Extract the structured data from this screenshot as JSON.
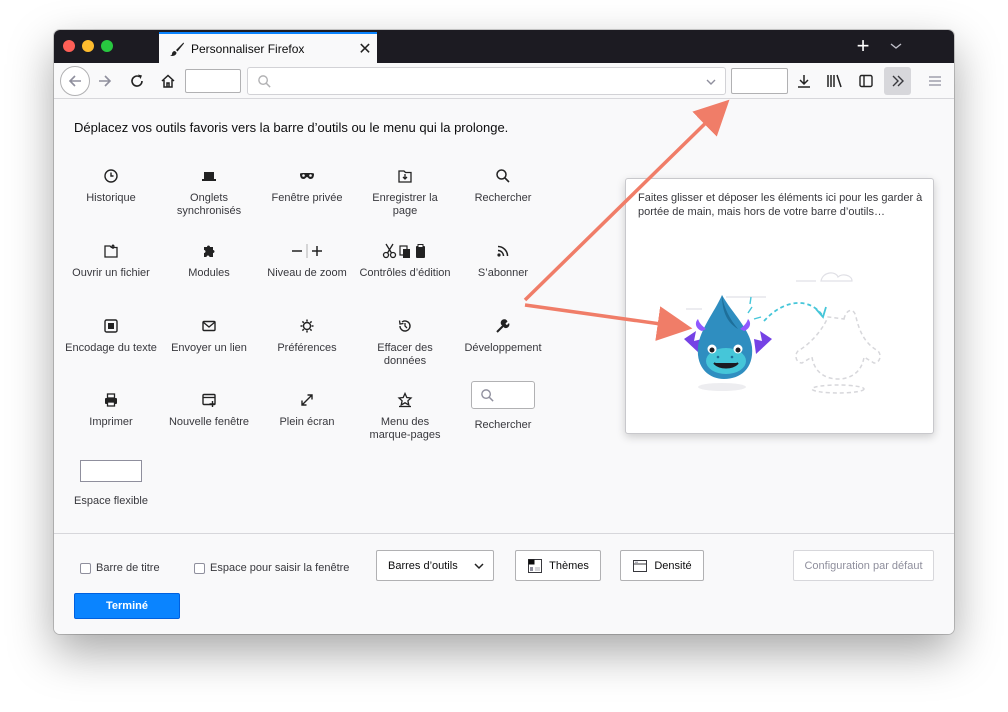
{
  "window": {
    "tab": {
      "title": "Personnaliser Firefox",
      "icon": "paintbrush-icon"
    },
    "new_tab_label": "+"
  },
  "navbar": {
    "icons": [
      "back-arrow-icon",
      "forward-arrow-icon",
      "reload-icon",
      "home-icon",
      "search-icon",
      "chevron-down-icon",
      "download-icon",
      "library-icon",
      "sidebar-icon",
      "overflow-chevrons-icon",
      "hamburger-menu-icon"
    ]
  },
  "content": {
    "heading": "Déplacez vos outils favoris vers la barre d’outils ou le menu qui la prolonge.",
    "palette": [
      {
        "label": "Historique",
        "icon": "clock-icon"
      },
      {
        "label": "Onglets synchronisés",
        "icon": "laptop-icon"
      },
      {
        "label": "Fenêtre privée",
        "icon": "mask-icon"
      },
      {
        "label": "Enregistrer la page",
        "icon": "save-page-icon"
      },
      {
        "label": "Rechercher",
        "icon": "search-icon"
      },
      {
        "label": "Ouvrir un fichier",
        "icon": "open-file-icon"
      },
      {
        "label": "Modules",
        "icon": "puzzle-icon"
      },
      {
        "label": "Niveau de zoom",
        "icon": "zoom-icon"
      },
      {
        "label": "Contrôles d’édition",
        "icon": "edit-controls-icon"
      },
      {
        "label": "S’abonner",
        "icon": "rss-icon"
      },
      {
        "label": "Encodage du texte",
        "icon": "text-encoding-icon"
      },
      {
        "label": "Envoyer un lien",
        "icon": "email-icon"
      },
      {
        "label": "Préférences",
        "icon": "gear-icon"
      },
      {
        "label": "Effacer des données",
        "icon": "forget-icon"
      },
      {
        "label": "Développement",
        "icon": "wrench-icon"
      },
      {
        "label": "Imprimer",
        "icon": "printer-icon"
      },
      {
        "label": "Nouvelle fenêtre",
        "icon": "new-window-icon"
      },
      {
        "label": "Plein écran",
        "icon": "fullscreen-icon"
      },
      {
        "label": "Menu des marque-pages",
        "icon": "bookmarks-menu-icon"
      },
      {
        "label": "Rechercher",
        "icon": "search-box-icon"
      },
      {
        "label": "Espace flexible",
        "icon": "flexible-space-icon"
      }
    ]
  },
  "panel": {
    "text": "Faites glisser et déposer les éléments ici pour les garder à portée de main, mais hors de votre barre d’outils…",
    "illustration": "dragon-illustration"
  },
  "footer": {
    "title_bar_label": "Barre de titre",
    "drag_space_label": "Espace pour saisir la fenêtre",
    "toolbars_label": "Barres d’outils",
    "themes_label": "Thèmes",
    "density_label": "Densité",
    "restore_label": "Configuration par défaut",
    "done_label": "Terminé"
  },
  "colors": {
    "accent": "#0a84ff",
    "arrow": "#f07d68",
    "tabbar": "#1c1b22"
  }
}
